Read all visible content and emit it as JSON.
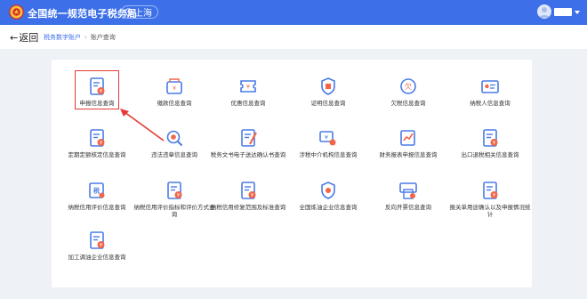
{
  "header": {
    "app_title": "全国统一规范电子税务局",
    "location": "上海",
    "user_name": ""
  },
  "nav": {
    "back_label": "返回",
    "breadcrumb": [
      "税务数字账户",
      "账户查询"
    ]
  },
  "colors": {
    "brand": "#3d6fe8",
    "icon_blue": "#4a7be6",
    "icon_red": "#f0664a",
    "highlight": "#e53935"
  },
  "tiles": [
    {
      "label": "申报信息查询",
      "icon": "declaration-doc-icon"
    },
    {
      "label": "缴款信息查询",
      "icon": "payment-wallet-icon"
    },
    {
      "label": "优惠信息查询",
      "icon": "discount-ticket-icon"
    },
    {
      "label": "证明信息查询",
      "icon": "certificate-shield-icon"
    },
    {
      "label": "欠税信息查询",
      "icon": "tax-arrears-icon"
    },
    {
      "label": "纳税人信息查询",
      "icon": "taxpayer-card-icon"
    },
    {
      "label": "定期定额核定信息查询",
      "icon": "fixed-quota-doc-icon"
    },
    {
      "label": "违法违章信息查询",
      "icon": "violation-search-icon"
    },
    {
      "label": "税务文书电子送达确认书查询",
      "icon": "document-pen-icon"
    },
    {
      "label": "涉税中介机构信息查询",
      "icon": "agency-money-icon"
    },
    {
      "label": "财务报表申报信息查询",
      "icon": "financial-report-icon"
    },
    {
      "label": "出口退税相关信息查询",
      "icon": "export-rebate-icon"
    },
    {
      "label": "纳税信用评价信息查询",
      "icon": "credit-rating-icon"
    },
    {
      "label": "纳税信用评价指标和评价方式查询",
      "icon": "credit-index-icon"
    },
    {
      "label": "纳税信用修复范围及标准查询",
      "icon": "credit-repair-icon"
    },
    {
      "label": "全国炼油企业信息查询",
      "icon": "refinery-icon"
    },
    {
      "label": "反向开票信息查询",
      "icon": "reverse-invoice-icon"
    },
    {
      "label": "报关单用途确认以及申报情况统计",
      "icon": "customs-declaration-icon"
    },
    {
      "label": "加工调油企业信息查询",
      "icon": "oil-blending-icon"
    }
  ]
}
